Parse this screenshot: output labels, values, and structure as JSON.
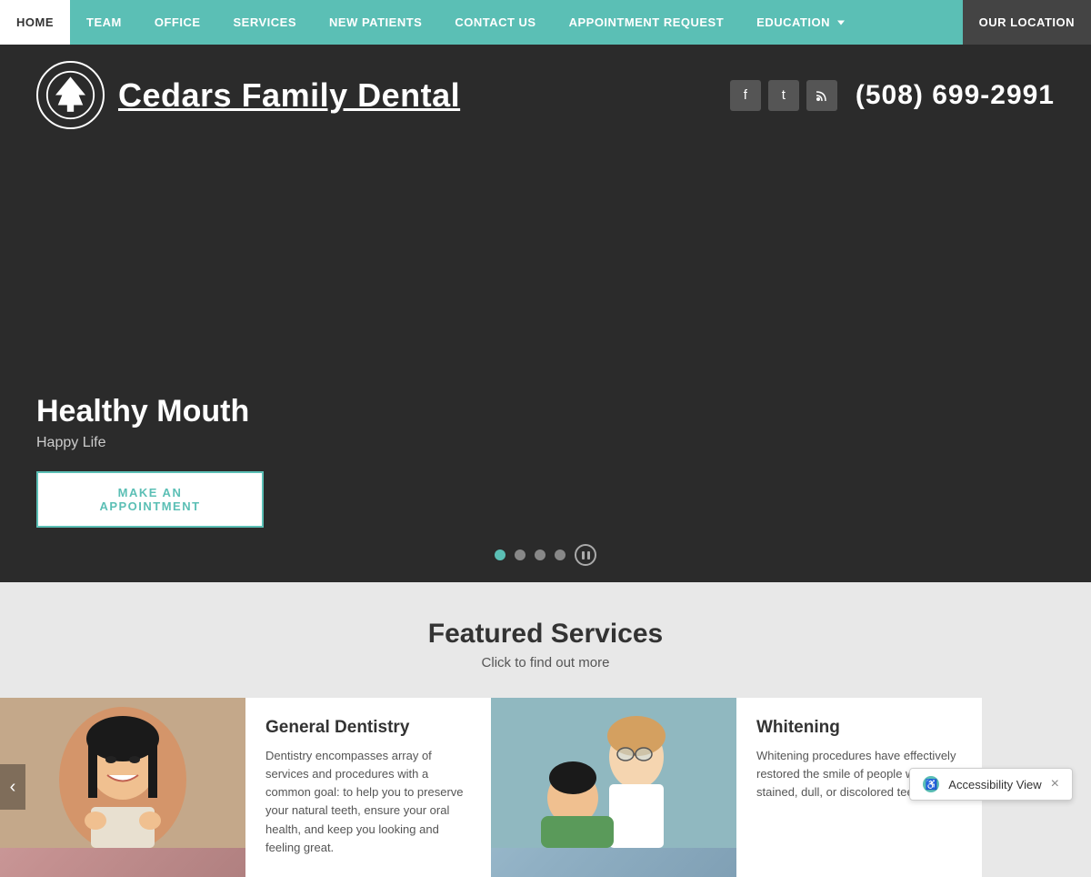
{
  "nav": {
    "items": [
      {
        "label": "HOME",
        "id": "home",
        "active": true
      },
      {
        "label": "TEAM",
        "id": "team",
        "active": false
      },
      {
        "label": "OFFICE",
        "id": "office",
        "active": false
      },
      {
        "label": "SERVICES",
        "id": "services",
        "active": false
      },
      {
        "label": "NEW PATIENTS",
        "id": "new-patients",
        "active": false
      },
      {
        "label": "CONTACT US",
        "id": "contact-us",
        "active": false
      },
      {
        "label": "APPOINTMENT REQUEST",
        "id": "appointment-request",
        "active": false
      },
      {
        "label": "EDUCATION",
        "id": "education",
        "active": false,
        "hasDropdown": true
      },
      {
        "label": "OUR LOCATION",
        "id": "our-location",
        "active": false,
        "special": true
      }
    ]
  },
  "header": {
    "site_title": "Cedars Family Dental",
    "phone": "(508) 699-2991",
    "social": [
      {
        "icon": "f",
        "name": "facebook"
      },
      {
        "icon": "t",
        "name": "twitter"
      },
      {
        "icon": "rss",
        "name": "rss"
      }
    ]
  },
  "hero": {
    "title": "Healthy Mouth",
    "subtitle": "Happy Life",
    "cta_label": "MAKE AN APPOINTMENT",
    "slides": [
      {
        "active": true
      },
      {
        "active": false
      },
      {
        "active": false
      },
      {
        "active": false
      }
    ]
  },
  "featured": {
    "title": "Featured Services",
    "subtitle": "Click to find out more",
    "services": [
      {
        "name": "General Dentistry",
        "description": "Dentistry encompasses array of services and procedures with a common goal: to help you to preserve your natural teeth, ensure your oral health, and keep you looking and feeling great.",
        "image_alt": "Patient smiling"
      },
      {
        "name": "Whitening",
        "description": "Whitening procedures have effectively restored the smile of people with stained, dull, or discolored teeth.",
        "image_alt": "Dentist with patient"
      }
    ]
  },
  "accessibility": {
    "label": "Accessibility View",
    "close_label": "×"
  }
}
